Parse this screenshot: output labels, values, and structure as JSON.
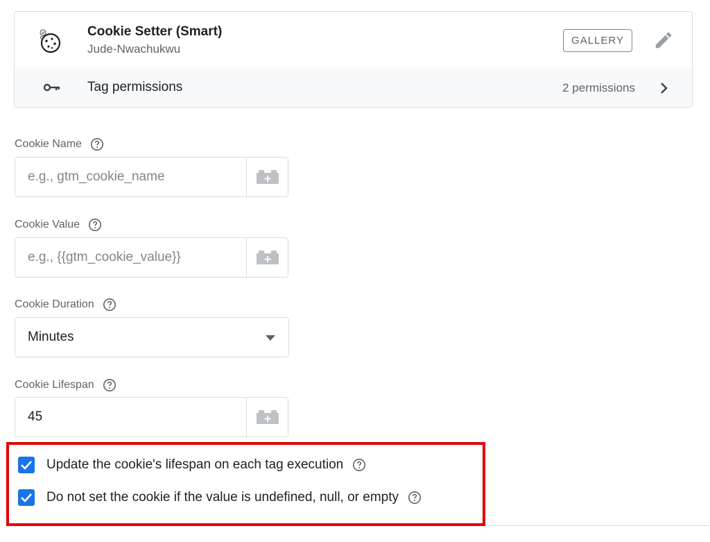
{
  "tag": {
    "title": "Cookie Setter (Smart)",
    "author": "Jude-Nwachukwu",
    "gallery_label": "GALLERY",
    "icon": "cookie-icon",
    "edit_icon": "pencil-icon"
  },
  "permissions": {
    "label": "Tag permissions",
    "count": "2 permissions",
    "icon": "key-icon"
  },
  "fields": {
    "cookie_name": {
      "label": "Cookie Name",
      "value": "",
      "placeholder": "e.g., gtm_cookie_name"
    },
    "cookie_value": {
      "label": "Cookie Value",
      "value": "",
      "placeholder": "e.g., {{gtm_cookie_value}}"
    },
    "cookie_duration": {
      "label": "Cookie Duration",
      "selected": "Minutes"
    },
    "cookie_lifespan": {
      "label": "Cookie Lifespan",
      "value": "45",
      "placeholder": ""
    }
  },
  "checkboxes": [
    {
      "label": "Update the cookie's lifespan on each tag execution",
      "checked": true
    },
    {
      "label": "Do not set the cookie if the value is undefined, null, or empty",
      "checked": true
    }
  ],
  "colors": {
    "accent": "#1a73e8",
    "highlight": "#e30000"
  }
}
